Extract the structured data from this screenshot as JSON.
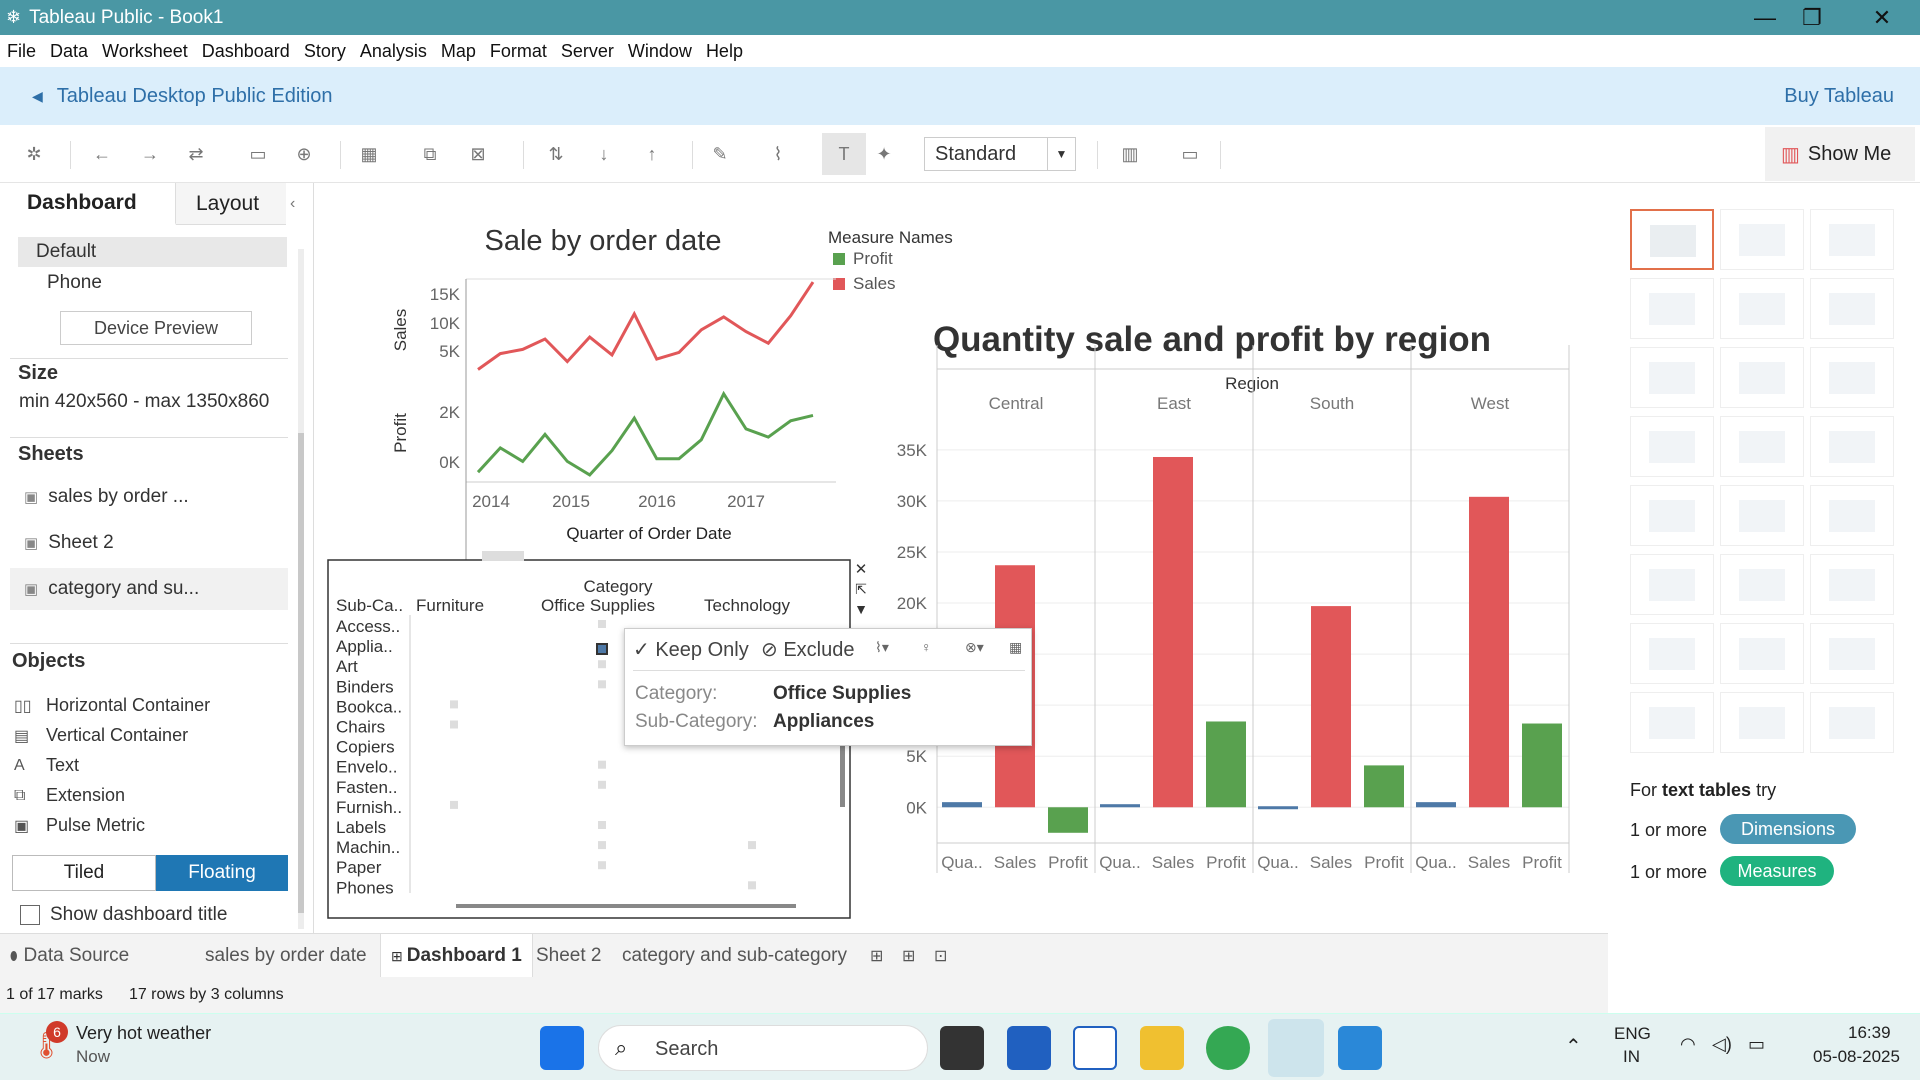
{
  "window": {
    "title": "Tableau Public - Book1",
    "minimize": "—",
    "restore": "❐",
    "close": "✕"
  },
  "menu": [
    "File",
    "Data",
    "Worksheet",
    "Dashboard",
    "Story",
    "Analysis",
    "Map",
    "Format",
    "Server",
    "Window",
    "Help"
  ],
  "banner": {
    "title": "Tableau Desktop Public Edition",
    "buy": "Buy Tableau"
  },
  "toolbar": {
    "fit": "Standard",
    "showme": "Show Me"
  },
  "left": {
    "tab_dashboard": "Dashboard",
    "tab_layout": "Layout",
    "devices": [
      "Default",
      "Phone"
    ],
    "device_preview": "Device Preview",
    "size_title": "Size",
    "size_value": "min 420x560 - max 1350x860",
    "sheets_title": "Sheets",
    "sheets": [
      "sales by order ...",
      "Sheet 2",
      "category and su..."
    ],
    "objects_title": "Objects",
    "objects": [
      {
        "label": "Horizontal Container",
        "icon": "horizontal-container-icon"
      },
      {
        "label": "Vertical Container",
        "icon": "vertical-container-icon"
      },
      {
        "label": "Text",
        "icon": "text-icon"
      },
      {
        "label": "Extension",
        "icon": "extension-icon"
      },
      {
        "label": "Pulse Metric",
        "icon": "pulse-metric-icon"
      }
    ],
    "tiled": "Tiled",
    "floating": "Floating",
    "show_title": "Show dashboard title"
  },
  "chart_data": [
    {
      "type": "line",
      "title": "Sale by order date",
      "xlabel": "Quarter of Order Date",
      "x_ticks": [
        "2014",
        "2015",
        "2016",
        "2017"
      ],
      "legend_title": "Measure Names",
      "legend": [
        {
          "name": "Profit",
          "color": "#59a14f"
        },
        {
          "name": "Sales",
          "color": "#e15759"
        }
      ],
      "panes": [
        {
          "ylabel": "Sales",
          "y_ticks": [
            "15K",
            "10K",
            "5K"
          ],
          "ylim": [
            0,
            17000
          ],
          "color": "#e15759",
          "values": [
            2200,
            4800,
            5500,
            7200,
            3500,
            7500,
            4600,
            11300,
            3900,
            5000,
            8700,
            10800,
            8400,
            6500,
            11000,
            16500
          ]
        },
        {
          "ylabel": "Profit",
          "y_ticks": [
            "2K",
            "0K"
          ],
          "ylim": [
            -500,
            3200
          ],
          "color": "#59a14f",
          "values": [
            -100,
            800,
            300,
            1300,
            300,
            -200,
            700,
            1900,
            400,
            400,
            1100,
            2800,
            1500,
            1200,
            1800,
            2000
          ]
        }
      ]
    },
    {
      "type": "bar",
      "title": "Quantity sale and profit by region",
      "header": "Region",
      "regions": [
        "Central",
        "East",
        "South",
        "West"
      ],
      "measures": [
        "Qua..",
        "Sales",
        "Profit"
      ],
      "y_ticks": [
        "35K",
        "30K",
        "25K",
        "20K",
        "15K",
        "10K",
        "5K",
        "0K"
      ],
      "ylim": [
        -3500,
        39000
      ],
      "colors": [
        "#4e79a7",
        "#e15759",
        "#59a14f"
      ],
      "values": [
        [
          500,
          23700,
          -2500
        ],
        [
          300,
          34300,
          8400
        ],
        [
          100,
          19700,
          4100
        ],
        [
          500,
          30400,
          8200
        ]
      ]
    },
    {
      "type": "table",
      "title": "Category",
      "header_row": "Sub-Ca..",
      "columns": [
        "Furniture",
        "Office Supplies",
        "Technology"
      ],
      "rows": [
        "Access..",
        "Applia..",
        "Art",
        "Binders",
        "Bookca..",
        "Chairs",
        "Copiers",
        "Envelo..",
        "Fasten..",
        "Furnish..",
        "Labels",
        "Machin..",
        "Paper",
        "Phones"
      ]
    }
  ],
  "popup": {
    "keep": "Keep Only",
    "exclude": "Exclude",
    "cat_label": "Category:",
    "cat_value": "Office Supplies",
    "sub_label": "Sub-Category:",
    "sub_value": "Appliances"
  },
  "showme": {
    "hint_prefix": "For",
    "hint_bold": "text tables",
    "hint_suffix": "try",
    "r1": "1 or more",
    "dim": "Dimensions",
    "r2": "1 or more",
    "mea": "Measures"
  },
  "tabs": {
    "source": "Data Source",
    "t1": "sales by order date",
    "t2": "Dashboard 1",
    "t3": "Sheet 2",
    "t4": "category and sub-category"
  },
  "status": {
    "marks": "1 of 17 marks",
    "rows": "17 rows by 3 columns"
  },
  "taskbar": {
    "weather": "Very hot weather",
    "weather_sub": "Now",
    "badge": "6",
    "search": "Search",
    "lang1": "ENG",
    "lang2": "IN",
    "time": "16:39",
    "date": "05-08-2025"
  }
}
